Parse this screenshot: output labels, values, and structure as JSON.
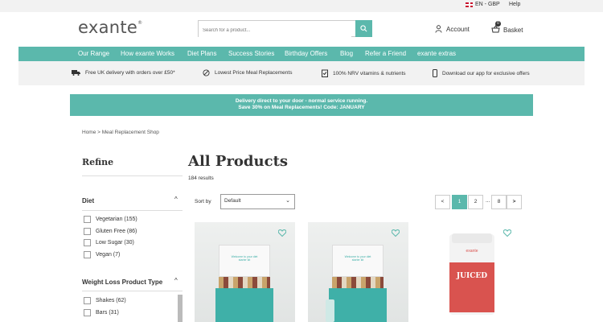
{
  "topbar": {
    "language": "EN - GBP",
    "help": "Help"
  },
  "header": {
    "logo": "exante",
    "logo_mark": "®",
    "search_placeholder": "Search for a product...",
    "account_label": "Account",
    "basket_label": "Basket",
    "basket_count": "0"
  },
  "nav": {
    "items": [
      "Our Range",
      "How exante Works",
      "Diet Plans",
      "Success Stories",
      "Birthday Offers",
      "Blog",
      "Refer a Friend",
      "exante extras"
    ]
  },
  "usp": {
    "items": [
      "Free UK delivery with orders over £50*",
      "Lowest Price Meal Replacements",
      "100% NRV vitamins & nutrients",
      "Download our app for exclusive offers"
    ]
  },
  "banner": {
    "line1": "Delivery direct to your door - normal service running.",
    "line2": "Save 30% on Meal Replacements! Code: JANUARY"
  },
  "breadcrumb": {
    "text": "Home  >  Meal Replacement Shop"
  },
  "sidebar": {
    "title": "Refine",
    "diet": {
      "heading": "Diet",
      "options": [
        "Vegetarian (155)",
        "Gluten Free (86)",
        "Low Sugar (30)",
        "Vegan (7)"
      ]
    },
    "product_type": {
      "heading": "Weight Loss Product Type",
      "options": [
        "Shakes (62)",
        "Bars (31)"
      ]
    }
  },
  "main": {
    "title": "All Products",
    "results": "184 results",
    "sort_label": "Sort by",
    "sort_value": "Default"
  },
  "pagination": {
    "prev": "<",
    "pages": [
      "1",
      "2",
      "8"
    ],
    "ellipsis": "...",
    "next": ">"
  },
  "products": {
    "box_text": "Welcome to your diet starter kit",
    "tub_brand": "exante",
    "tub_name": "JUICED"
  },
  "colors": {
    "accent": "#5bb8ac",
    "banner_bg": "#5bb8ac"
  }
}
